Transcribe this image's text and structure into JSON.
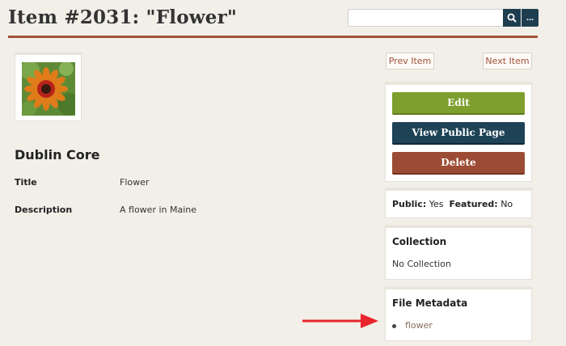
{
  "page": {
    "title": "Item #2031: \"Flower\""
  },
  "search": {
    "placeholder": "",
    "value": "",
    "search_icon": "search-icon",
    "advanced_label": "..."
  },
  "item": {
    "thumbnail_icon": "flower-image",
    "section_heading": "Dublin Core",
    "fields": [
      {
        "label": "Title",
        "value": "Flower"
      },
      {
        "label": "Description",
        "value": "A flower in Maine"
      }
    ]
  },
  "nav": {
    "prev_label": "Prev Item",
    "next_label": "Next Item"
  },
  "actions": {
    "edit_label": "Edit",
    "view_label": "View Public Page",
    "delete_label": "Delete"
  },
  "status": {
    "public_label": "Public:",
    "public_value": "Yes",
    "featured_label": "Featured:",
    "featured_value": "No"
  },
  "collection": {
    "heading": "Collection",
    "value": "No Collection"
  },
  "file_metadata": {
    "heading": "File Metadata",
    "files": [
      "flower"
    ]
  },
  "colors": {
    "accent": "#a6503a",
    "edit": "#7e9f2d",
    "view": "#1e4256",
    "delete": "#9c4c34",
    "arrow": "#e8242c"
  }
}
